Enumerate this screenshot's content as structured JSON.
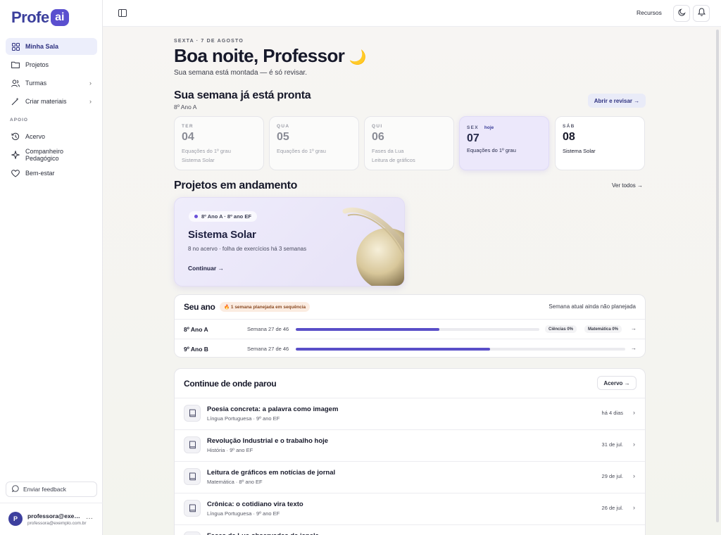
{
  "brand": {
    "logo_text": "Profe",
    "logo_badge": "ai"
  },
  "sidebar": {
    "items": [
      {
        "label": "Minha Sala",
        "icon": "grid-icon",
        "active": true
      },
      {
        "label": "Projetos",
        "icon": "folder-icon"
      },
      {
        "label": "Turmas",
        "icon": "users-icon",
        "chevron": "›"
      },
      {
        "label": "Criar materiais",
        "icon": "wand-icon",
        "chevron": "›"
      }
    ],
    "section_label": "APOIO",
    "support_items": [
      {
        "label": "Acervo",
        "icon": "history-icon"
      },
      {
        "label": "Companheiro Pedagógico",
        "icon": "sparkle-icon"
      },
      {
        "label": "Bem-estar",
        "icon": "heart-icon"
      }
    ],
    "feedback_label": "Enviar feedback",
    "user": {
      "initial": "P",
      "name": "professora@exemplo.com.br",
      "email": "professora@exemplo.com.br",
      "more": "···"
    }
  },
  "topbar": {
    "recursos_label": "Recursos",
    "theme_icon": "moon-icon",
    "bell_icon": "bell-icon"
  },
  "header": {
    "date": "SEXTA · 7 DE AGOSTO",
    "greeting": "Boa noite, Professor",
    "greeting_emoji": "🌙",
    "subtitle": "Sua semana está montada — é só revisar."
  },
  "week": {
    "title": "Sua semana já está pronta",
    "class_label": "8º Ano A",
    "review_button": "Abrir e revisar →",
    "days": [
      {
        "dn": "TER",
        "num": "04",
        "lines": [
          "Equações do 1º grau",
          "Sistema Solar"
        ],
        "state": "past"
      },
      {
        "dn": "QUA",
        "num": "05",
        "lines": [
          "Equações do 1º grau"
        ],
        "state": "past"
      },
      {
        "dn": "QUI",
        "num": "06",
        "lines": [
          "Fases da Lua",
          "Leitura de gráficos"
        ],
        "state": "past"
      },
      {
        "dn": "SEX",
        "num": "07",
        "lines": [
          "Equações do 1º grau"
        ],
        "state": "today",
        "badge": "hoje"
      },
      {
        "dn": "SÁB",
        "num": "08",
        "lines": [
          "Sistema Solar"
        ],
        "state": "future"
      }
    ]
  },
  "projects": {
    "title": "Projetos em andamento",
    "see_all": "Ver todos →",
    "card": {
      "badge": "8º Ano A · 8º ano EF",
      "title": "Sistema Solar",
      "subtitle": "8 no acervo · folha de exercícios há 3 semanas",
      "continue_label": "Continuar →"
    }
  },
  "year": {
    "title": "Seu ano",
    "streak": "🔥 1 semana planejada em sequência",
    "note": "Semana atual ainda não planejada",
    "rows": [
      {
        "class": "8º Ano A",
        "week": "Semana 27 de 46",
        "progress": 0.59,
        "chips": [
          "Ciências 0%",
          "Matemática 0%"
        ]
      },
      {
        "class": "9º Ano B",
        "week": "Semana 27 de 46",
        "progress": 0.59,
        "chips": []
      }
    ]
  },
  "continue": {
    "title": "Continue de onde parou",
    "acervo_button": "Acervo →",
    "items": [
      {
        "title": "Poesia concreta: a palavra como imagem",
        "sub": "Língua Portuguesa · 9º ano EF",
        "date": "há 4 dias"
      },
      {
        "title": "Revolução Industrial e o trabalho hoje",
        "sub": "História · 9º ano EF",
        "date": "31 de jul."
      },
      {
        "title": "Leitura de gráficos em notícias de jornal",
        "sub": "Matemática · 8º ano EF",
        "date": "29 de jul."
      },
      {
        "title": "Crônica: o cotidiano vira texto",
        "sub": "Língua Portuguesa · 9º ano EF",
        "date": "26 de jul."
      },
      {
        "title": "Fases da Lua observadas da janela",
        "sub": "",
        "date": ""
      }
    ]
  }
}
